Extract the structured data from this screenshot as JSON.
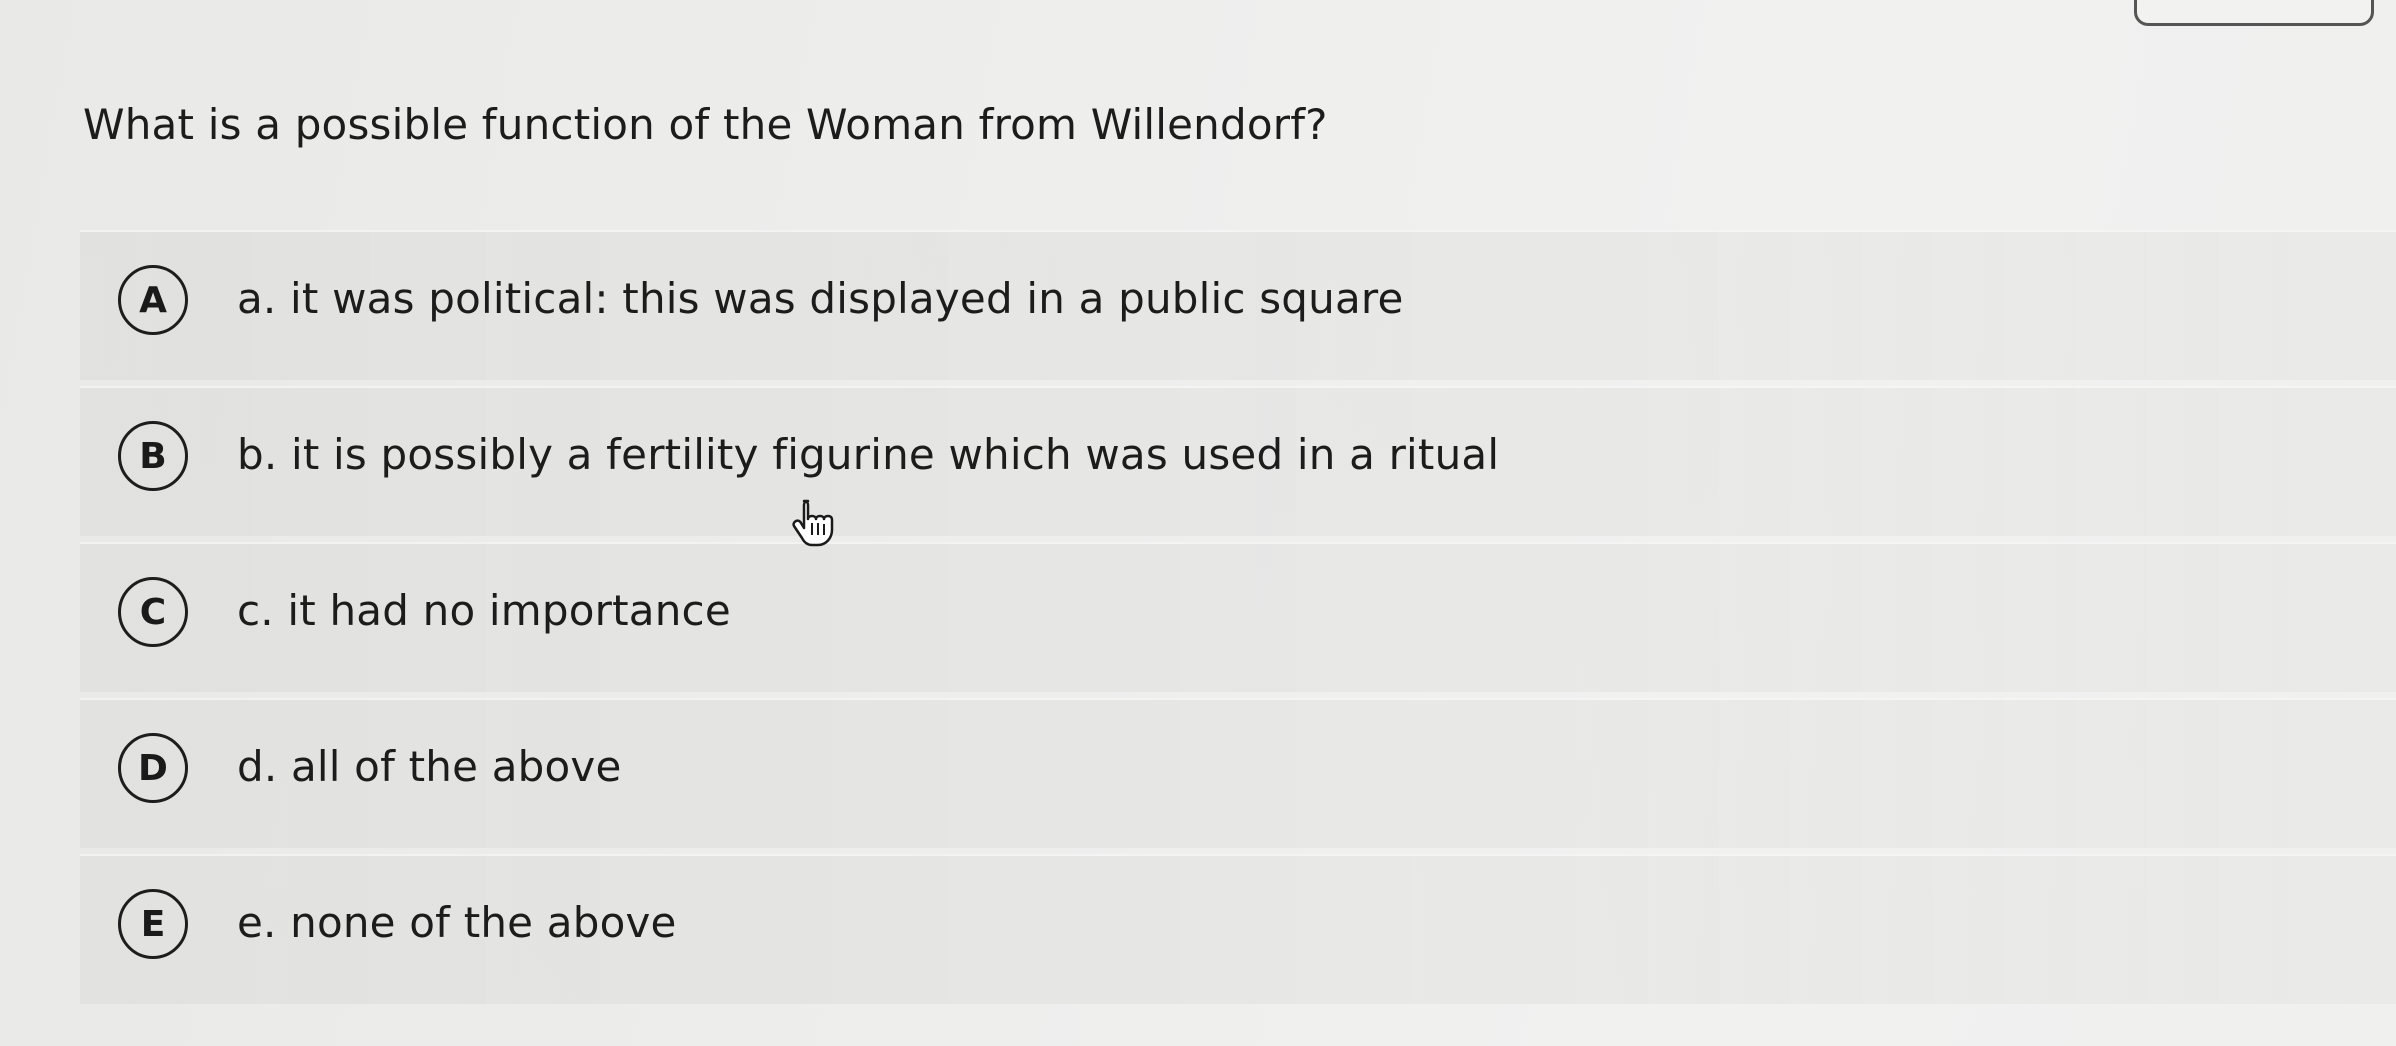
{
  "question": {
    "text": "What is a possible function of the Woman from Willendorf?"
  },
  "options": [
    {
      "letter": "A",
      "text": "a. it was political: this was displayed in a public square"
    },
    {
      "letter": "B",
      "text": "b. it is possibly a fertility figurine which was used in a ritual"
    },
    {
      "letter": "C",
      "text": "c. it had no importance"
    },
    {
      "letter": "D",
      "text": "d. all of the above"
    },
    {
      "letter": "E",
      "text": "e. none of the above"
    }
  ],
  "colors": {
    "background": "#ededec",
    "option_row": "#dededc",
    "text": "#1c1c1c",
    "badge_border": "#1d1d1d"
  },
  "icons": {
    "cursor": "hand-pointer-icon"
  }
}
